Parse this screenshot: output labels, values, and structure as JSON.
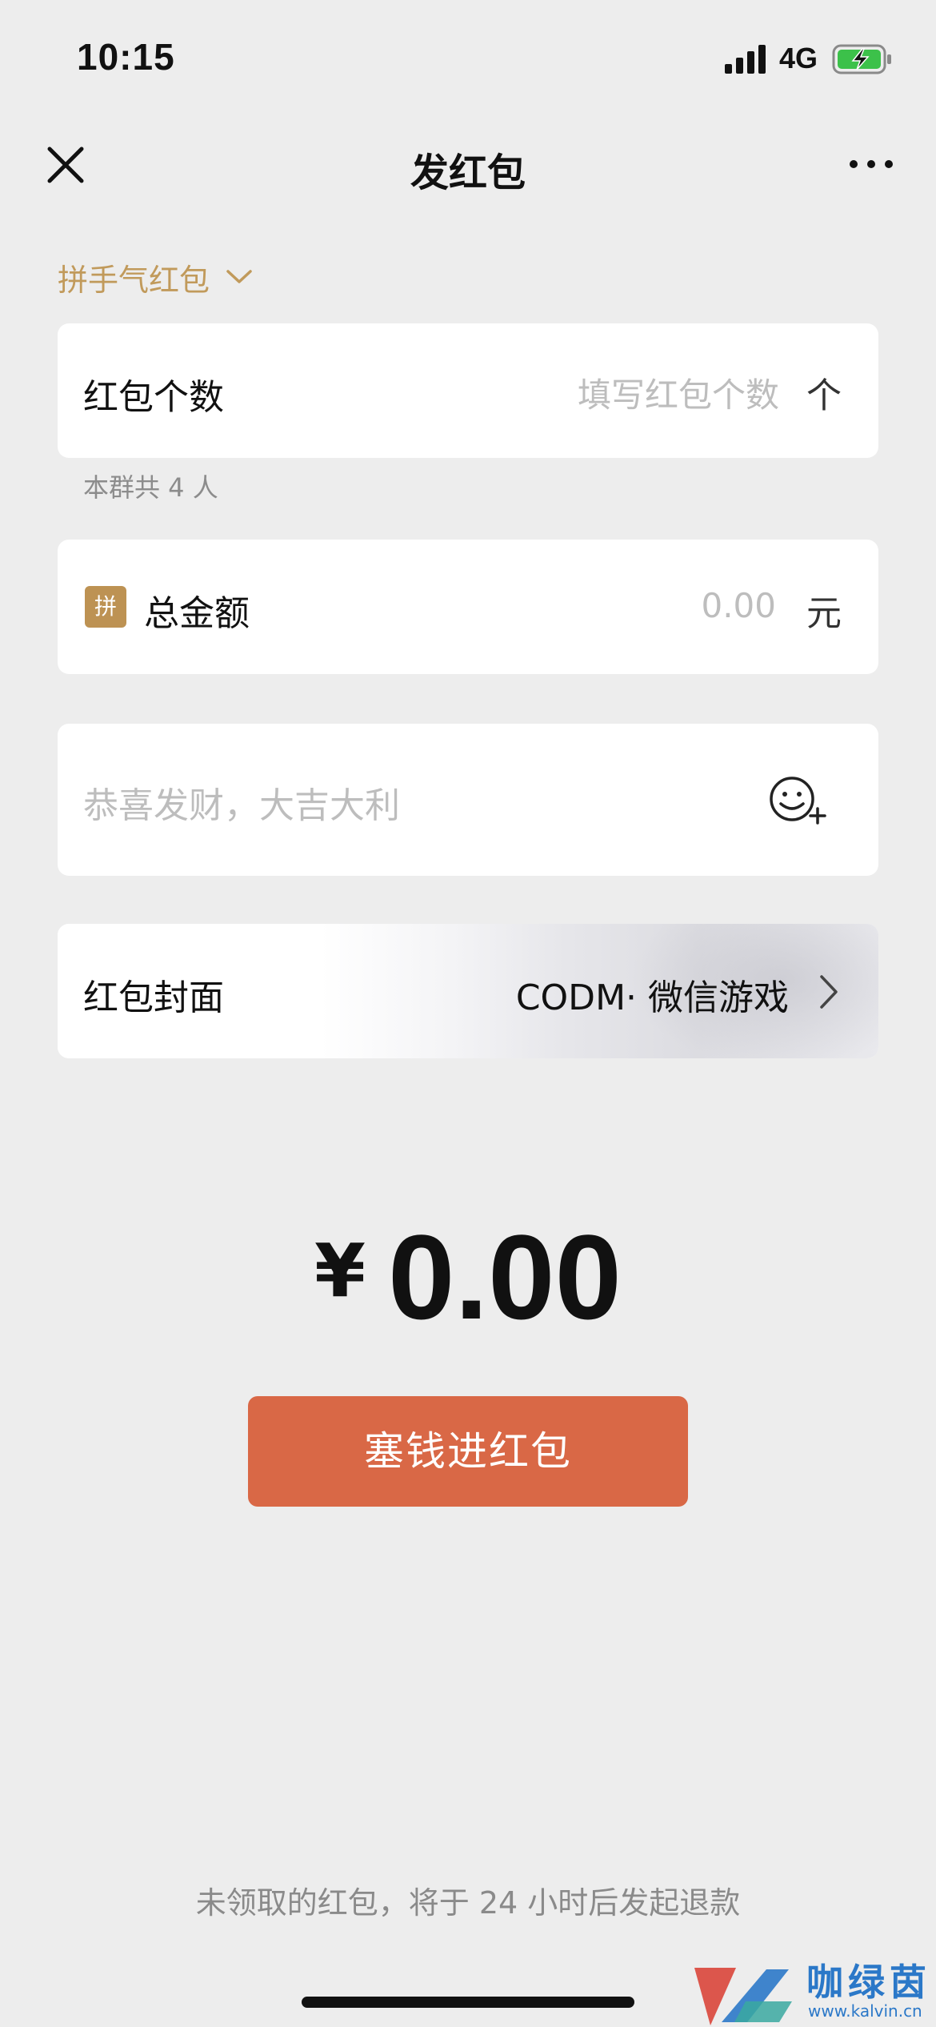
{
  "status_bar": {
    "time": "10:15",
    "network": "4G",
    "battery_charging": true,
    "battery_color": "#3cc14a"
  },
  "nav": {
    "title": "发红包",
    "close_icon": "close-icon",
    "more_icon": "more-dots-icon"
  },
  "type_selector": {
    "label": "拼手气红包",
    "icon": "chevron-down-icon",
    "color": "#c19a5b"
  },
  "count_field": {
    "label": "红包个数",
    "placeholder": "填写红包个数",
    "unit": "个"
  },
  "group_note": "本群共 4 人",
  "amount_field": {
    "badge": "拼",
    "label": "总金额",
    "placeholder": "0.00",
    "unit": "元"
  },
  "greeting_field": {
    "placeholder": "恭喜发财，大吉大利",
    "icon": "emoji-add-icon"
  },
  "cover_field": {
    "label": "红包封面",
    "value": "CODM· 微信游戏",
    "icon": "chevron-right-icon"
  },
  "total_display": {
    "currency": "¥",
    "amount": "0.00"
  },
  "submit_button": {
    "label": "塞钱进红包",
    "color": "#d96846"
  },
  "refund_note": "未领取的红包，将于 24 小时后发起退款",
  "watermark": {
    "name": "咖绿茵",
    "url": "www.kalvin.cn"
  }
}
